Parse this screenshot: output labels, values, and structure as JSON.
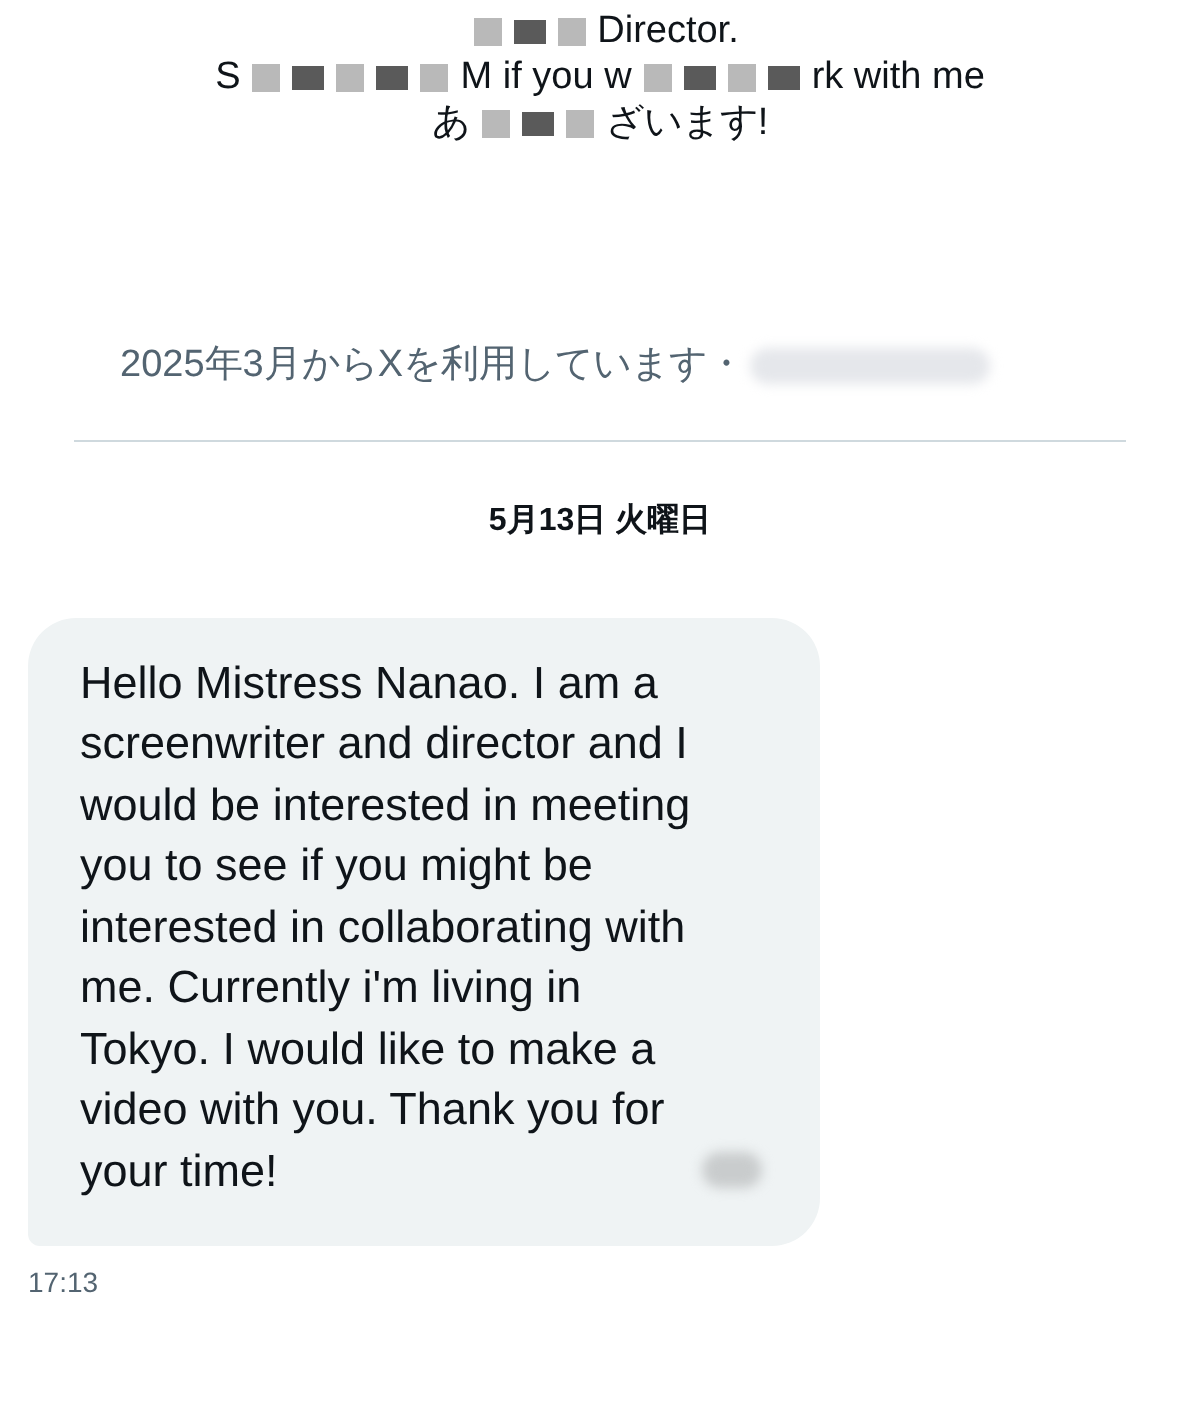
{
  "bio": {
    "lines": [
      {
        "segments": [
          {
            "kind": "mosaic"
          },
          {
            "kind": "text",
            "text": "Director."
          }
        ]
      },
      {
        "segments": [
          {
            "kind": "text",
            "text": "S"
          },
          {
            "kind": "mosaic"
          },
          {
            "kind": "text",
            "text": "M if you w"
          },
          {
            "kind": "mosaic"
          },
          {
            "kind": "text",
            "text": "rk with me"
          }
        ]
      },
      {
        "segments": [
          {
            "kind": "text",
            "text": "あ"
          },
          {
            "kind": "mosaic"
          },
          {
            "kind": "text",
            "text": "ざいます!"
          }
        ]
      }
    ]
  },
  "joined": "2025年3月からXを利用しています・",
  "date": "5月13日 火曜日",
  "messages": [
    {
      "text": "Hello Mistress Nanao. I am a screenwriter and director and I would be interested in meeting you to see if you might be interested in collaborating with me. Currently i'm living in Tokyo. I would like to make a video with you. Thank you for your time!",
      "time": "17:13"
    }
  ]
}
